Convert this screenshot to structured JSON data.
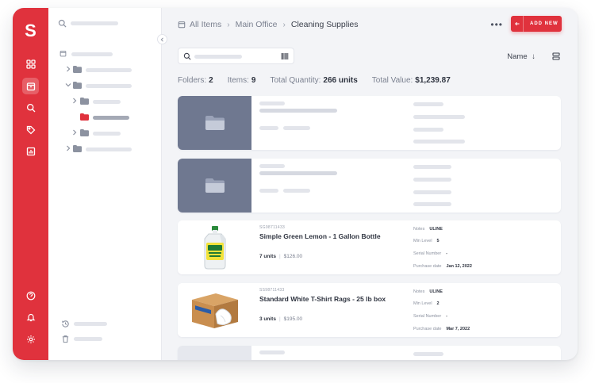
{
  "app": {
    "logo_letter": "S"
  },
  "rail": {
    "top_icons": [
      "dashboard-icon",
      "items-icon",
      "search-icon",
      "tags-icon",
      "reports-icon"
    ],
    "bottom_icons": [
      "help-icon",
      "bell-icon",
      "settings-icon"
    ]
  },
  "breadcrumb": {
    "root": "All Items",
    "level1": "Main Office",
    "current": "Cleaning Supplies"
  },
  "toolbar": {
    "add_label": "ADD NEW",
    "sort_label": "Name"
  },
  "stats": {
    "folders_label": "Folders:",
    "folders_value": "2",
    "items_label": "Items:",
    "items_value": "9",
    "qty_label": "Total Quantity:",
    "qty_value": "266 units",
    "value_label": "Total Value:",
    "value_value": "$1,239.87"
  },
  "items": [
    {
      "sku": "SG98711433",
      "name": "Simple Green Lemon - 1 Gallon Bottle",
      "units": "7 units",
      "price": "$126.00",
      "notes_label": "Notes",
      "notes": "ULINE",
      "min_label": "Min Level",
      "min": "5",
      "serial_label": "Serial Number",
      "serial": "-",
      "date_label": "Purchase date",
      "date": "Jan 12, 2022"
    },
    {
      "sku": "SS98711433",
      "name": "Standard White T-Shirt Rags - 25 lb box",
      "units": "3 units",
      "price": "$195.00",
      "notes_label": "Notes",
      "notes": "ULINE",
      "min_label": "Min Level",
      "min": "2",
      "serial_label": "Serial Number",
      "serial": "-",
      "date_label": "Purchase date",
      "date": "Mar 7, 2022"
    }
  ]
}
